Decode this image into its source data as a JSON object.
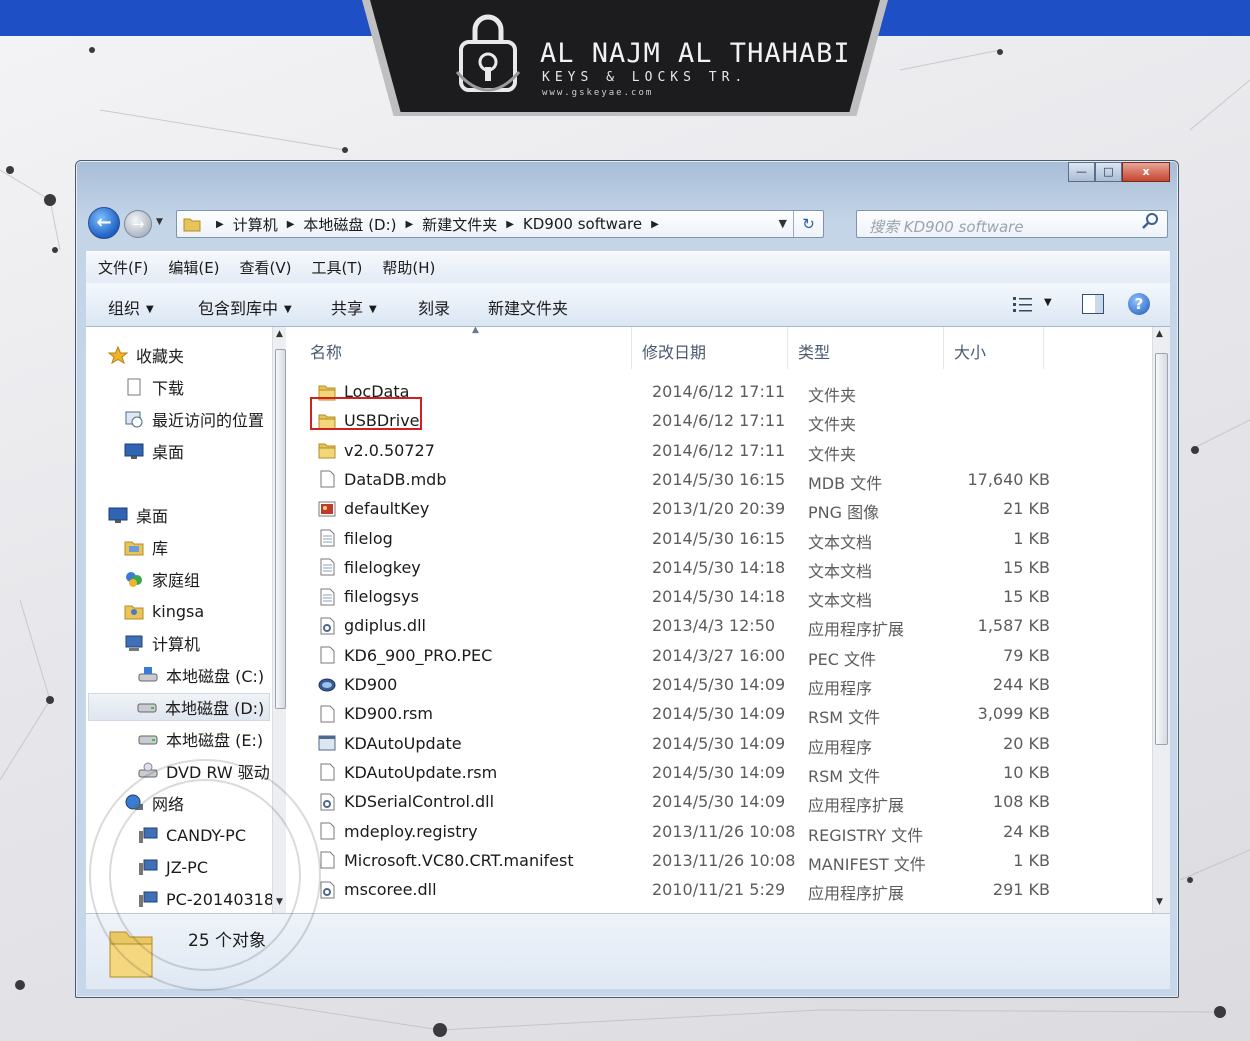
{
  "brand": {
    "name": "AL NAJM AL THAHABI",
    "subtitle": "KEYS & LOCKS TR.",
    "url": "www.gskeyae.com"
  },
  "window": {
    "controls": {
      "minimize": "—",
      "maximize": "□",
      "close": "x"
    }
  },
  "address": {
    "crumbs": [
      "计算机",
      "本地磁盘 (D:)",
      "新建文件夹",
      "KD900 software"
    ],
    "search_placeholder": "搜索 KD900 software"
  },
  "menu": [
    "文件(F)",
    "编辑(E)",
    "查看(V)",
    "工具(T)",
    "帮助(H)"
  ],
  "toolbar": {
    "organize": "组织",
    "include_library": "包含到库中",
    "share": "共享",
    "burn": "刻录",
    "new_folder": "新建文件夹"
  },
  "nav": {
    "favorites": "收藏夹",
    "downloads": "下载",
    "recent": "最近访问的位置",
    "desktop_fav": "桌面",
    "desktop": "桌面",
    "libraries": "库",
    "homegroup": "家庭组",
    "user": "kingsa",
    "computer": "计算机",
    "drive_c": "本地磁盘 (C:)",
    "drive_d": "本地磁盘 (D:)",
    "drive_e": "本地磁盘 (E:)",
    "dvd": "DVD RW 驱动",
    "network": "网络",
    "pc1": "CANDY-PC",
    "pc2": "JZ-PC",
    "pc3": "PC-20140318"
  },
  "columns": {
    "name": "名称",
    "date": "修改日期",
    "type": "类型",
    "size": "大小"
  },
  "files": [
    {
      "name": "LocData",
      "date": "2014/6/12 17:11",
      "type": "文件夹",
      "size": "",
      "icon": "folder-icon"
    },
    {
      "name": "USBDrive",
      "date": "2014/6/12 17:11",
      "type": "文件夹",
      "size": "",
      "icon": "folder-icon"
    },
    {
      "name": "v2.0.50727",
      "date": "2014/6/12 17:11",
      "type": "文件夹",
      "size": "",
      "icon": "folder-icon"
    },
    {
      "name": "DataDB.mdb",
      "date": "2014/5/30 16:15",
      "type": "MDB 文件",
      "size": "17,640 KB",
      "icon": "file-icon"
    },
    {
      "name": "defaultKey",
      "date": "2013/1/20 20:39",
      "type": "PNG 图像",
      "size": "21 KB",
      "icon": "image-icon"
    },
    {
      "name": "filelog",
      "date": "2014/5/30 16:15",
      "type": "文本文档",
      "size": "1 KB",
      "icon": "text-file-icon"
    },
    {
      "name": "filelogkey",
      "date": "2014/5/30 14:18",
      "type": "文本文档",
      "size": "15 KB",
      "icon": "text-file-icon"
    },
    {
      "name": "filelogsys",
      "date": "2014/5/30 14:18",
      "type": "文本文档",
      "size": "15 KB",
      "icon": "text-file-icon"
    },
    {
      "name": "gdiplus.dll",
      "date": "2013/4/3 12:50",
      "type": "应用程序扩展",
      "size": "1,587 KB",
      "icon": "dll-icon"
    },
    {
      "name": "KD6_900_PRO.PEC",
      "date": "2014/3/27 16:00",
      "type": "PEC 文件",
      "size": "79 KB",
      "icon": "file-icon"
    },
    {
      "name": "KD900",
      "date": "2014/5/30 14:09",
      "type": "应用程序",
      "size": "244 KB",
      "icon": "app-icon"
    },
    {
      "name": "KD900.rsm",
      "date": "2014/5/30 14:09",
      "type": "RSM 文件",
      "size": "3,099 KB",
      "icon": "file-icon"
    },
    {
      "name": "KDAutoUpdate",
      "date": "2014/5/30 14:09",
      "type": "应用程序",
      "size": "20 KB",
      "icon": "window-app-icon"
    },
    {
      "name": "KDAutoUpdate.rsm",
      "date": "2014/5/30 14:09",
      "type": "RSM 文件",
      "size": "10 KB",
      "icon": "file-icon"
    },
    {
      "name": "KDSerialControl.dll",
      "date": "2014/5/30 14:09",
      "type": "应用程序扩展",
      "size": "108 KB",
      "icon": "dll-icon"
    },
    {
      "name": "mdeploy.registry",
      "date": "2013/11/26 10:08",
      "type": "REGISTRY 文件",
      "size": "24 KB",
      "icon": "file-icon"
    },
    {
      "name": "Microsoft.VC80.CRT.manifest",
      "date": "2013/11/26 10:08",
      "type": "MANIFEST 文件",
      "size": "1 KB",
      "icon": "file-icon"
    },
    {
      "name": "mscoree.dll",
      "date": "2010/11/21 5:29",
      "type": "应用程序扩展",
      "size": "291 KB",
      "icon": "dll-icon"
    }
  ],
  "status": {
    "count": "25 个对象"
  },
  "colors": {
    "accent_blue": "#1e4fc4",
    "highlight_red": "#d21f1f",
    "banner_dark": "#1c1c1e"
  }
}
